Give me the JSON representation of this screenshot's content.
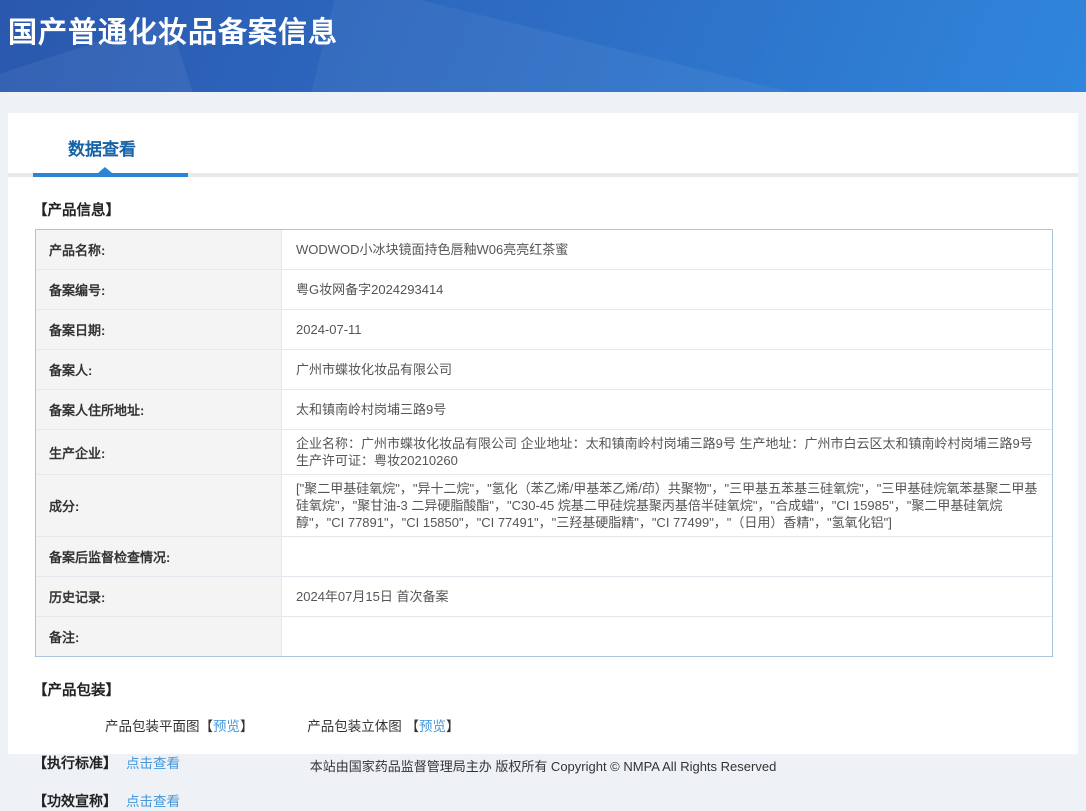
{
  "header": {
    "title": "国产普通化妆品备案信息"
  },
  "tab": {
    "label": "数据查看"
  },
  "product_info": {
    "section_title": "【产品信息】",
    "rows": [
      {
        "label": "产品名称:",
        "value": "WODWOD小冰块镜面持色唇釉W06亮亮红茶蜜"
      },
      {
        "label": "备案编号:",
        "value": "粤G妆网备字2024293414"
      },
      {
        "label": "备案日期:",
        "value": "2024-07-11"
      },
      {
        "label": "备案人:",
        "value": "广州市蝶妆化妆品有限公司"
      },
      {
        "label": "备案人住所地址:",
        "value": "太和镇南岭村岗埔三路9号"
      },
      {
        "label": "生产企业:",
        "value": "企业名称：广州市蝶妆化妆品有限公司 企业地址：太和镇南岭村岗埔三路9号 生产地址：广州市白云区太和镇南岭村岗埔三路9号 生产许可证：粤妆20210260"
      },
      {
        "label": "成分:",
        "value": "[\"聚二甲基硅氧烷\"，\"异十二烷\"，\"氢化（苯乙烯/甲基苯乙烯/茚）共聚物\"，\"三甲基五苯基三硅氧烷\"，\"三甲基硅烷氧苯基聚二甲基硅氧烷\"，\"聚甘油-3 二异硬脂酸酯\"，\"C30-45 烷基二甲硅烷基聚丙基倍半硅氧烷\"，\"合成蜡\"，\"CI 15985\"，\"聚二甲基硅氧烷醇\"，\"CI 77891\"，\"CI 15850\"，\"CI 77491\"，\"三羟基硬脂精\"，\"CI 77499\"，\"（日用）香精\"，\"氢氧化铝\"]"
      },
      {
        "label": "备案后监督检查情况:",
        "value": ""
      },
      {
        "label": "历史记录:",
        "value": "2024年07月15日 首次备案"
      },
      {
        "label": "备注:",
        "value": ""
      }
    ]
  },
  "packaging": {
    "section_title": "【产品包装】",
    "flat": {
      "label": "产品包装平面图",
      "open": "【",
      "link": "预览",
      "close": "】"
    },
    "stereo": {
      "label": "产品包装立体图 ",
      "open": "【",
      "link": "预览",
      "close": "】"
    }
  },
  "standard": {
    "title": "【执行标准】",
    "link": "点击查看"
  },
  "efficacy": {
    "title": "【功效宣称】",
    "link": "点击查看"
  },
  "footer": {
    "text": "本站由国家药品监督管理局主办 版权所有 Copyright © NMPA All Rights Reserved"
  },
  "colors": {
    "banner_blue_start": "#2a58ae",
    "banner_blue_end": "#2f86dc",
    "tab_text": "#1663a8",
    "tab_underline": "#2e84d4",
    "link_blue": "#4697d9",
    "table_border": "#aac4dc",
    "label_bg": "#f4f4f5"
  }
}
